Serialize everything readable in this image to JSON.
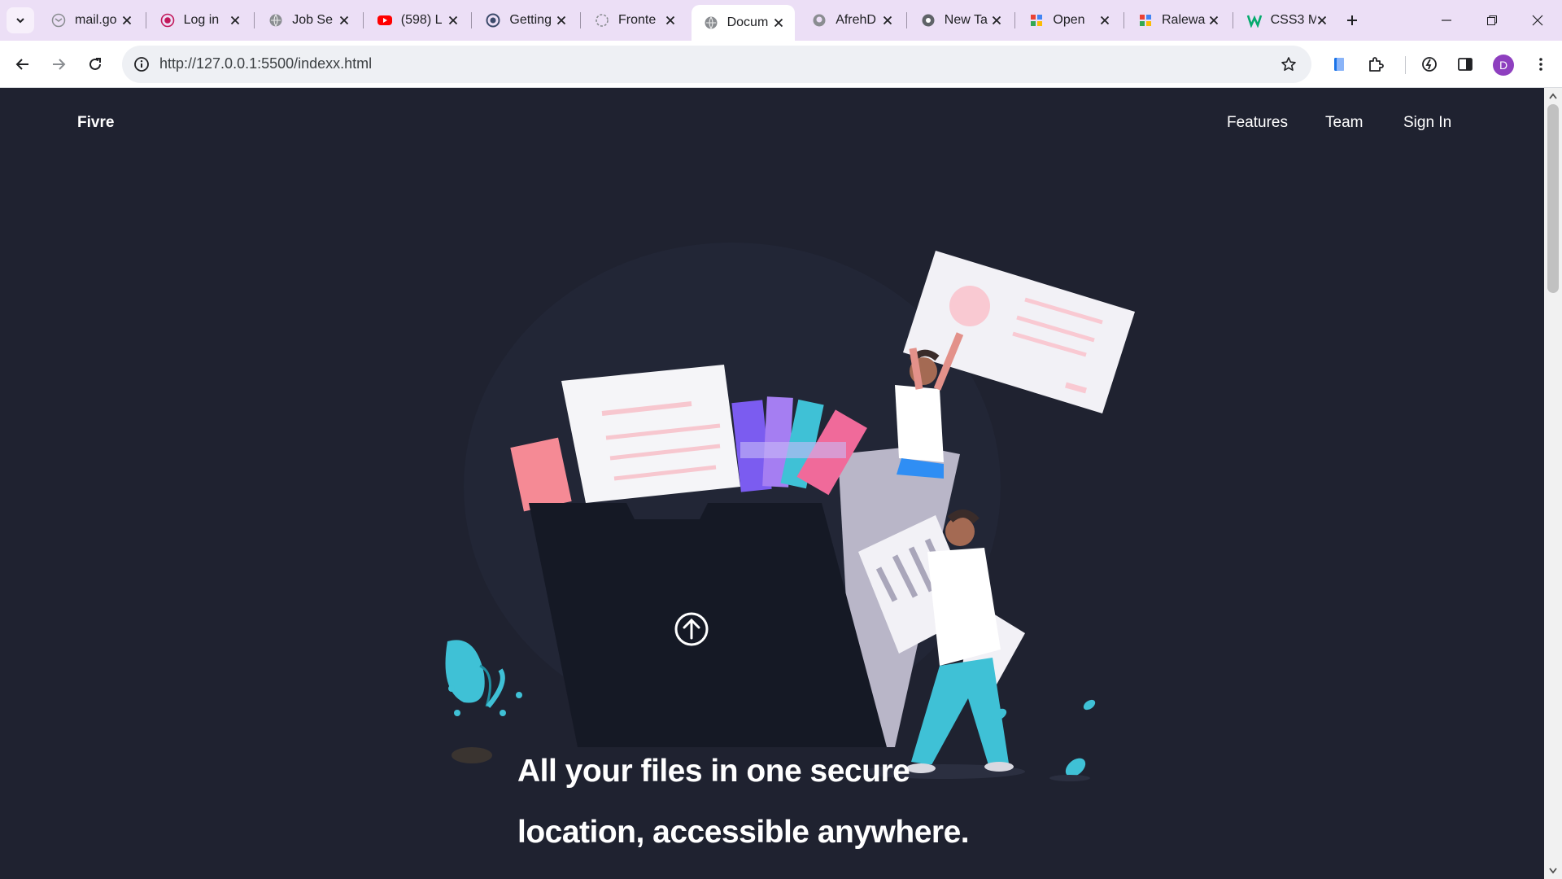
{
  "browser": {
    "tabs": [
      {
        "title": "mail.go",
        "icon": "gmail-icon"
      },
      {
        "title": "Log in",
        "icon": "record-icon"
      },
      {
        "title": "Job Se",
        "icon": "globe-icon"
      },
      {
        "title": "(598) L",
        "icon": "youtube-icon"
      },
      {
        "title": "Getting",
        "icon": "circle-icon"
      },
      {
        "title": "Fronte",
        "icon": "loading-icon"
      },
      {
        "title": "Docum",
        "icon": "globe-icon",
        "active": true
      },
      {
        "title": "AfrehD",
        "icon": "github-icon"
      },
      {
        "title": "New Ta",
        "icon": "chrome-icon"
      },
      {
        "title": "Open",
        "icon": "puzzle-colors-icon"
      },
      {
        "title": "Ralewa",
        "icon": "puzzle-colors-icon"
      },
      {
        "title": "CSS3 M",
        "icon": "w-icon"
      }
    ],
    "url": "http://127.0.0.1:5500/indexx.html",
    "profile_initial": "D"
  },
  "site": {
    "logo": "Fivre",
    "nav": {
      "features": "Features",
      "team": "Team",
      "signin": "Sign In"
    },
    "headline_line1": "All your files in one secure",
    "headline_line2": "location, accessible anywhere."
  },
  "colors": {
    "page_bg": "#1f2230",
    "accent_pink": "#f49aa8",
    "accent_teal": "#3fc1d6",
    "accent_purple": "#7b5cf0"
  }
}
